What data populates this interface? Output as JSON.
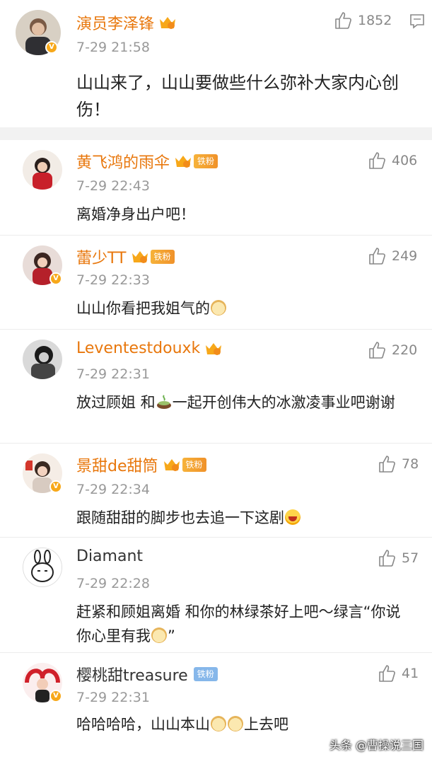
{
  "post": {
    "author": "演员李泽锋",
    "time": "7-29 21:58",
    "likes": "1852",
    "text": "山山来了，山山要做些什么弥补大家内心创伤！"
  },
  "comments": [
    {
      "name": "黄飞鸿的雨伞",
      "badge": "铁粉",
      "time": "7-29 22:43",
      "likes": "406",
      "text": "离婚净身出户吧！"
    },
    {
      "name": "蕾少TT",
      "badge": "铁粉",
      "time": "7-29 22:33",
      "likes": "249",
      "text_before": "山山你看把我姐气的",
      "text_after": ""
    },
    {
      "name": "Leventestdouxk",
      "time": "7-29 22:31",
      "likes": "220",
      "text_before": "放过顾姐 和",
      "text_after": "一起开创伟大的冰激凌事业吧谢谢"
    },
    {
      "name": "景甜de甜筒",
      "badge": "铁粉",
      "time": "7-29 22:34",
      "likes": "78",
      "text_before": "跟随甜甜的脚步也去追一下这剧",
      "text_after": ""
    },
    {
      "name": "Diamant",
      "time": "7-29 22:28",
      "likes": "57",
      "text_before": "赶紧和顾姐离婚 和你的林绿茶好上吧～绿言“你说你心里有我",
      "text_after": "”"
    },
    {
      "name": "樱桃甜treasure",
      "badge": "铁粉",
      "time": "7-29 22:31",
      "likes": "41",
      "text_before": "哈哈哈哈，山山本山",
      "text_after": "上去吧"
    }
  ],
  "watermark": "头条 @曹操说三国",
  "colors": {
    "name": "#e8770c",
    "separator": "#f2f2f2",
    "vip": "#f7a81a"
  }
}
